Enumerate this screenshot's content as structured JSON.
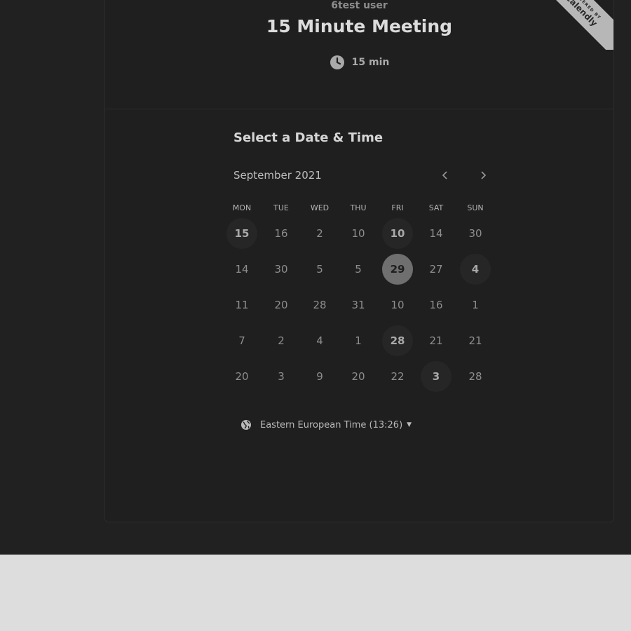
{
  "event": {
    "host": "6test user",
    "title": "15 Minute Meeting",
    "duration": "15 min"
  },
  "ribbon": {
    "powered_by": "POWERED BY",
    "brand": "Calendly"
  },
  "calendar": {
    "heading": "Select a Date & Time",
    "month": "September 2021",
    "prev_icon": "chevron-left-icon",
    "next_icon": "chevron-right-icon",
    "weekdays": [
      "MON",
      "TUE",
      "WED",
      "THU",
      "FRI",
      "SAT",
      "SUN"
    ],
    "weeks": [
      [
        {
          "d": "15",
          "s": "available"
        },
        {
          "d": "16",
          "s": ""
        },
        {
          "d": "2",
          "s": ""
        },
        {
          "d": "10",
          "s": ""
        },
        {
          "d": "10",
          "s": "available"
        },
        {
          "d": "14",
          "s": ""
        },
        {
          "d": "30",
          "s": ""
        }
      ],
      [
        {
          "d": "14",
          "s": ""
        },
        {
          "d": "30",
          "s": ""
        },
        {
          "d": "5",
          "s": ""
        },
        {
          "d": "5",
          "s": ""
        },
        {
          "d": "29",
          "s": "selected"
        },
        {
          "d": "27",
          "s": ""
        },
        {
          "d": "4",
          "s": "available"
        }
      ],
      [
        {
          "d": "11",
          "s": ""
        },
        {
          "d": "20",
          "s": ""
        },
        {
          "d": "28",
          "s": ""
        },
        {
          "d": "31",
          "s": ""
        },
        {
          "d": "10",
          "s": ""
        },
        {
          "d": "16",
          "s": ""
        },
        {
          "d": "1",
          "s": ""
        }
      ],
      [
        {
          "d": "7",
          "s": ""
        },
        {
          "d": "2",
          "s": ""
        },
        {
          "d": "4",
          "s": ""
        },
        {
          "d": "1",
          "s": ""
        },
        {
          "d": "28",
          "s": "available"
        },
        {
          "d": "21",
          "s": ""
        },
        {
          "d": "21",
          "s": ""
        }
      ],
      [
        {
          "d": "20",
          "s": ""
        },
        {
          "d": "3",
          "s": ""
        },
        {
          "d": "9",
          "s": ""
        },
        {
          "d": "20",
          "s": ""
        },
        {
          "d": "22",
          "s": ""
        },
        {
          "d": "3",
          "s": "available"
        },
        {
          "d": "28",
          "s": ""
        }
      ]
    ]
  },
  "timezone": {
    "label": "Eastern European Time (13:26)",
    "icon": "globe-icon"
  },
  "colors": {
    "page_background": "#212121",
    "card_background": "#1f1f1f",
    "selected_day": "#6f6f6f",
    "lower_area": "#dddddd"
  }
}
